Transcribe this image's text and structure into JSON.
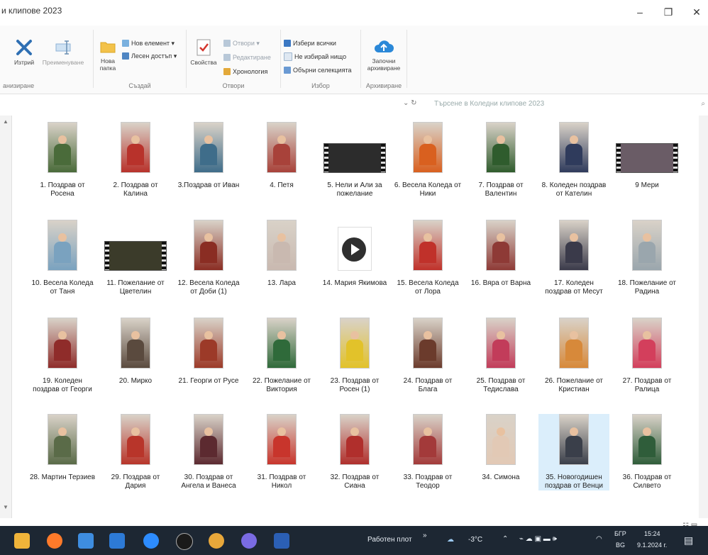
{
  "window": {
    "title": "и клипове 2023",
    "minimize": "–",
    "maximize": "❐",
    "close": "✕"
  },
  "ribbon": {
    "organize": {
      "label": "анизиране",
      "delete": "Изтрий",
      "rename": "Преименуване"
    },
    "create": {
      "label": "Създай",
      "new_folder": "Нова папка",
      "new_item": "Нов елемент ▾",
      "easy_access": "Лесен достъп ▾"
    },
    "open": {
      "label": "Отвори",
      "properties": "Свойства",
      "open": "Отвори ▾",
      "edit": "Редактиране",
      "history": "Хронология"
    },
    "select": {
      "label": "Избор",
      "select_all": "Избери всички",
      "select_none": "Не избирай нищо",
      "invert": "Обърни селекцията"
    },
    "archive": {
      "label": "Архивиране",
      "start": "Започни архивиране"
    }
  },
  "address": {
    "nav": "⌄ ↻",
    "search_placeholder": "Търсене в Коледни клипове 2023",
    "search_icon": "search-icon"
  },
  "files": [
    {
      "name": "1. Поздрав от Росена",
      "kind": "portrait",
      "color": "#4a6b3a"
    },
    {
      "name": "2. Поздрав от Калина",
      "kind": "portrait",
      "color": "#b8322b"
    },
    {
      "name": "3.Поздрав от Иван",
      "kind": "portrait",
      "color": "#3f6d8a"
    },
    {
      "name": "4. Петя",
      "kind": "portrait",
      "color": "#a8423a"
    },
    {
      "name": "5. Нели и Али за пожелание",
      "kind": "landscape",
      "color": "#2c2c2c"
    },
    {
      "name": "6. Весела Коледа от Ники",
      "kind": "portrait",
      "color": "#d9601f"
    },
    {
      "name": "7. Поздрав от Валентин",
      "kind": "portrait",
      "color": "#2f5c2d"
    },
    {
      "name": "8. Коледен поздрав от Кателин",
      "kind": "portrait",
      "color": "#2f3b5c"
    },
    {
      "name": "9 Мери",
      "kind": "landscape",
      "color": "#6a5c66"
    },
    {
      "name": "10. Весела Коледа от Таня",
      "kind": "portrait",
      "color": "#7aa2bf"
    },
    {
      "name": "11. Пожелание от Цветелин",
      "kind": "landscape",
      "color": "#3b3b2a"
    },
    {
      "name": "12. Весела Коледа от Доби (1)",
      "kind": "portrait",
      "color": "#8a2d23"
    },
    {
      "name": "13. Лара",
      "kind": "portrait",
      "color": "#c9b9b0"
    },
    {
      "name": "14. Мария Якимова",
      "kind": "doc",
      "color": "#2f2f2f"
    },
    {
      "name": "15. Весела Коледа от Лора",
      "kind": "portrait",
      "color": "#c0312a"
    },
    {
      "name": "16. Вяра от Варна",
      "kind": "portrait",
      "color": "#8e3a36"
    },
    {
      "name": "17. Коледен поздрав от Месут",
      "kind": "portrait",
      "color": "#3a3a4a"
    },
    {
      "name": "18. Пожелание от Радина",
      "kind": "portrait",
      "color": "#9aa6ad"
    },
    {
      "name": "19. Коледен поздрав от Георги",
      "kind": "portrait",
      "color": "#8f2c2a"
    },
    {
      "name": "20. Мирко",
      "kind": "portrait",
      "color": "#5a4a3e"
    },
    {
      "name": "21. Георги от Русе",
      "kind": "portrait",
      "color": "#9c3a28"
    },
    {
      "name": "22. Пожелание от Виктория",
      "kind": "portrait",
      "color": "#2f6a3a"
    },
    {
      "name": "23. Поздрав от Росен (1)",
      "kind": "portrait",
      "color": "#e2c22a"
    },
    {
      "name": "24. Поздрав от Блага",
      "kind": "portrait",
      "color": "#6b3b2c"
    },
    {
      "name": "25. Поздрав от Тедислава",
      "kind": "portrait",
      "color": "#c23c5a"
    },
    {
      "name": "26. Пожелание от Кристиан",
      "kind": "portrait",
      "color": "#d7893a"
    },
    {
      "name": "27. Поздрав от Ралица",
      "kind": "portrait",
      "color": "#d33f5c"
    },
    {
      "name": "28. Мартин Терзиев",
      "kind": "portrait",
      "color": "#5a6b48"
    },
    {
      "name": "29. Поздрав от Дария",
      "kind": "portrait",
      "color": "#b8352a"
    },
    {
      "name": "30. Поздрав от Ангела и Ванеса",
      "kind": "portrait",
      "color": "#5c2a30"
    },
    {
      "name": "31. Поздрав от Никол",
      "kind": "portrait",
      "color": "#c8352c"
    },
    {
      "name": "32. Поздрав от Сиана",
      "kind": "portrait",
      "color": "#b02f2c"
    },
    {
      "name": "33. Поздрав от Теодор",
      "kind": "portrait",
      "color": "#a33a3a"
    },
    {
      "name": "34. Симона",
      "kind": "portrait",
      "color": "#e2c9b5"
    },
    {
      "name": "35. Новогодишен поздрав от Венци",
      "kind": "portrait",
      "color": "#3a3f4a",
      "selected": true
    },
    {
      "name": "36. Поздрав от Силвето",
      "kind": "portrait",
      "color": "#2f5d3a"
    }
  ],
  "taskbar": {
    "desktop": "Работен плот",
    "chevron": "»",
    "weather": "-3°C",
    "lang_top": "БГР",
    "lang_bottom": "BG",
    "time": "15:24",
    "date": "9.1.2024 г."
  }
}
